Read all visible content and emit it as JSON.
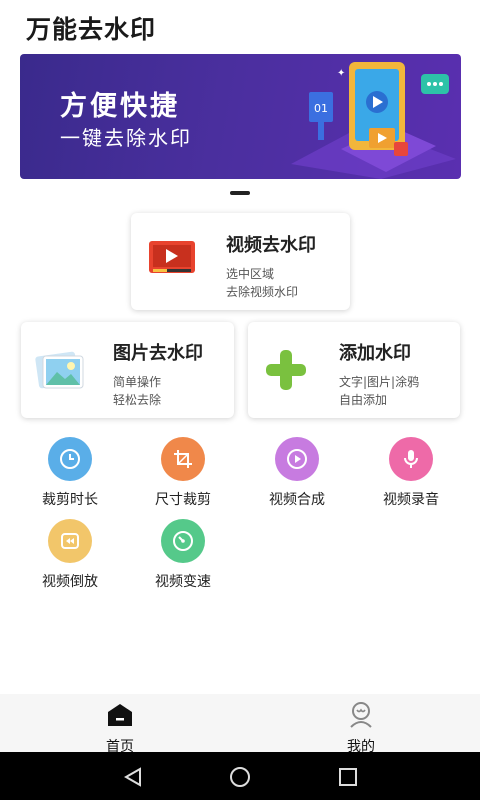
{
  "app": {
    "title": "万能去水印"
  },
  "banner": {
    "title": "方便快捷",
    "subtitle": "一键去除水印",
    "screen_number": "01"
  },
  "cards": {
    "video": {
      "title": "视频去水印",
      "line1": "选中区域",
      "line2": "去除视频水印"
    },
    "image": {
      "title": "图片去水印",
      "line1": "简单操作",
      "line2": "轻松去除"
    },
    "add": {
      "title": "添加水印",
      "line1": "文字|图片|涂鸦",
      "line2": "自由添加"
    }
  },
  "tools": [
    {
      "label": "裁剪时长",
      "icon": "clock-icon",
      "color": "#5aaee8"
    },
    {
      "label": "尺寸裁剪",
      "icon": "crop-icon",
      "color": "#f0884a"
    },
    {
      "label": "视频合成",
      "icon": "play-circle-icon",
      "color": "#c77be0"
    },
    {
      "label": "视频录音",
      "icon": "microphone-icon",
      "color": "#ee6aa8"
    },
    {
      "label": "视频倒放",
      "icon": "rewind-icon",
      "color": "#f2c66a"
    },
    {
      "label": "视频变速",
      "icon": "speed-icon",
      "color": "#55c98a"
    }
  ],
  "nav": {
    "home": "首页",
    "mine": "我的"
  }
}
